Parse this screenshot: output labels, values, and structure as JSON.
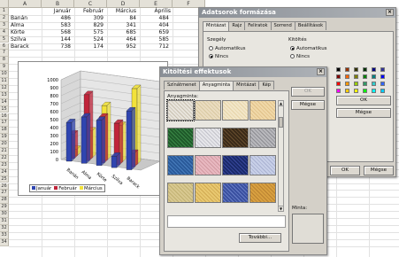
{
  "sheet": {
    "columns": [
      "A",
      "B",
      "C",
      "D",
      "E",
      "F"
    ],
    "header_row": [
      "",
      "Január",
      "Február",
      "Március",
      "Április"
    ],
    "rows": [
      {
        "name": "Banán",
        "values": [
          "486",
          "309",
          "84",
          "484"
        ]
      },
      {
        "name": "Alma",
        "values": [
          "583",
          "829",
          "341",
          "404"
        ]
      },
      {
        "name": "Körte",
        "values": [
          "568",
          "575",
          "685",
          "659"
        ]
      },
      {
        "name": "Szilva",
        "values": [
          "144",
          "524",
          "464",
          "585"
        ]
      },
      {
        "name": "Barack",
        "values": [
          "738",
          "174",
          "952",
          "712"
        ]
      }
    ],
    "row_numbers": [
      "1",
      "2",
      "3",
      "4",
      "5",
      "6",
      "7",
      "8",
      "9",
      "10",
      "11",
      "12",
      "13",
      "14",
      "15",
      "16",
      "17",
      "18",
      "19",
      "20",
      "21",
      "22",
      "23",
      "24",
      "25",
      "26",
      "27",
      "28",
      "29",
      "30",
      "31",
      "32",
      "33",
      "34"
    ]
  },
  "chart_data": {
    "type": "bar",
    "categories": [
      "Banán",
      "Alma",
      "Körte",
      "Szilva",
      "Barack"
    ],
    "series": [
      {
        "name": "Január",
        "values": [
          486,
          583,
          568,
          144,
          738
        ]
      },
      {
        "name": "Február",
        "values": [
          309,
          829,
          575,
          524,
          174
        ]
      },
      {
        "name": "Március",
        "values": [
          84,
          341,
          685,
          464,
          952
        ]
      }
    ],
    "ylim": [
      0,
      1000
    ],
    "y_ticks": [
      "0",
      "100",
      "200",
      "300",
      "400",
      "500",
      "600",
      "700",
      "800",
      "900",
      "1000"
    ],
    "legend_position": "bottom-left",
    "colors": [
      "#2f45b0",
      "#c0243a",
      "#f2e23a"
    ]
  },
  "format_dialog": {
    "title": "Adatsorok formázása",
    "close_glyph": "×",
    "tabs": [
      "Mintázat",
      "Rajz",
      "Feliratok",
      "Sorrend",
      "Beállítások"
    ],
    "border_label": "Szegély",
    "border_options": [
      "Automatikus",
      "Nincs"
    ],
    "fill_label": "Kitöltés",
    "fill_options": [
      "Automatikus",
      "Nincs"
    ],
    "ok_label": "OK",
    "cancel_label": "Mégse",
    "side_ok": "OK",
    "side_cancel": "Mégse",
    "swatch_colors": [
      "#000000",
      "#993300",
      "#333300",
      "#003300",
      "#000080",
      "#333399",
      "#800000",
      "#ff6600",
      "#808000",
      "#008000",
      "#008080",
      "#0000ff",
      "#ff0000",
      "#ff9900",
      "#99cc00",
      "#339966",
      "#33cccc",
      "#3366ff",
      "#ff00ff",
      "#ffcc00",
      "#ffff00",
      "#00ff00",
      "#00ffff",
      "#00ccff"
    ]
  },
  "fill_dialog": {
    "title": "Kitöltési effektusok",
    "close_glyph": "×",
    "tabs": [
      "Színátmenet",
      "Anyagminta",
      "Mintázat",
      "Kép"
    ],
    "texture_label": "Anyagminta:",
    "ok_label": "OK",
    "cancel_label": "Mégse",
    "more_button": "További...",
    "sample_label": "Minta:",
    "textures": [
      {
        "base": "#e8e4dc",
        "accent": "#c8c0b0"
      },
      {
        "base": "#eadcc0",
        "accent": "#d8c8a0"
      },
      {
        "base": "#f2e6c8",
        "accent": "#e6d4a8"
      },
      {
        "base": "#f0d8a8",
        "accent": "#e0c088"
      },
      {
        "base": "#1f5a2a",
        "accent": "#3c8a48"
      },
      {
        "base": "#e6e6ea",
        "accent": "#c0c0c8"
      },
      {
        "base": "#3a2a18",
        "accent": "#6a5030"
      },
      {
        "base": "#b8b8bc",
        "accent": "#8a8a90"
      },
      {
        "base": "#2a5a9a",
        "accent": "#4a80c0"
      },
      {
        "base": "#e8b8c0",
        "accent": "#d098a0"
      },
      {
        "base": "#1a2a6a",
        "accent": "#3a4aa0"
      },
      {
        "base": "#c8d0e8",
        "accent": "#a8b0d0"
      },
      {
        "base": "#d8c890",
        "accent": "#c0b070"
      },
      {
        "base": "#e8c870",
        "accent": "#d0a850"
      },
      {
        "base": "#3a50a0",
        "accent": "#6a80c8"
      },
      {
        "base": "#d8a040",
        "accent": "#b88030"
      }
    ]
  }
}
